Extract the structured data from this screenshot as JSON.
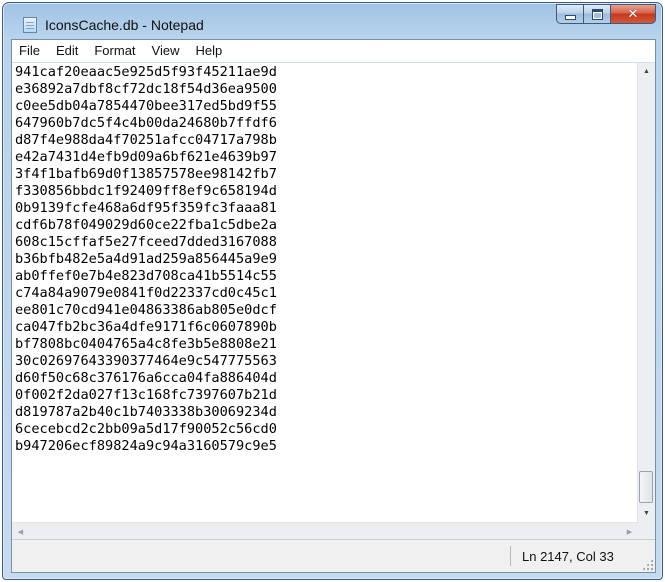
{
  "window": {
    "title": "IconsCache.db - Notepad"
  },
  "menu": [
    "File",
    "Edit",
    "Format",
    "View",
    "Help"
  ],
  "editor": {
    "lines": [
      "941caf20eaac5e925d5f93f45211ae9d",
      "e36892a7dbf8cf72dc18f54d36ea9500",
      "c0ee5db04a7854470bee317ed5bd9f55",
      "647960b7dc5f4c4b00da24680b7ffdf6",
      "d87f4e988da4f70251afcc04717a798b",
      "e42a7431d4efb9d09a6bf621e4639b97",
      "3f4f1bafb69d0f13857578ee98142fb7",
      "f330856bbdc1f92409ff8ef9c658194d",
      "0b9139fcfe468a6df95f359fc3faaa81",
      "cdf6b78f049029d60ce22fba1c5dbe2a",
      "608c15cffaf5e27fceed7dded3167088",
      "b36bfb482e5a4d91ad259a856445a9e9",
      "ab0ffef0e7b4e823d708ca41b5514c55",
      "c74a84a9079e0841f0d22337cd0c45c1",
      "ee801c70cd941e04863386ab805e0dcf",
      "ca047fb2bc36a4dfe9171f6c0607890b",
      "bf7808bc0404765a4c8fe3b5e8808e21",
      "30c02697643390377464e9c547775563",
      "d60f50c68c376176a6cca04fa886404d",
      "0f002f2da027f13c168fc7397607b21d",
      "d819787a2b40c1b7403338b30069234d",
      "6cecebcd2c2bb09a5d17f90052c56cd0",
      "b947206ecf89824a9c94a3160579c9e5"
    ]
  },
  "statusbar": {
    "position": "Ln 2147, Col 33"
  },
  "icons": {
    "app": "notepad-icon",
    "minimize": "minimize-icon",
    "maximize": "maximize-icon",
    "close": "close-icon"
  },
  "colors": {
    "frame": "#b8d3ec",
    "close_button": "#c4391f"
  }
}
